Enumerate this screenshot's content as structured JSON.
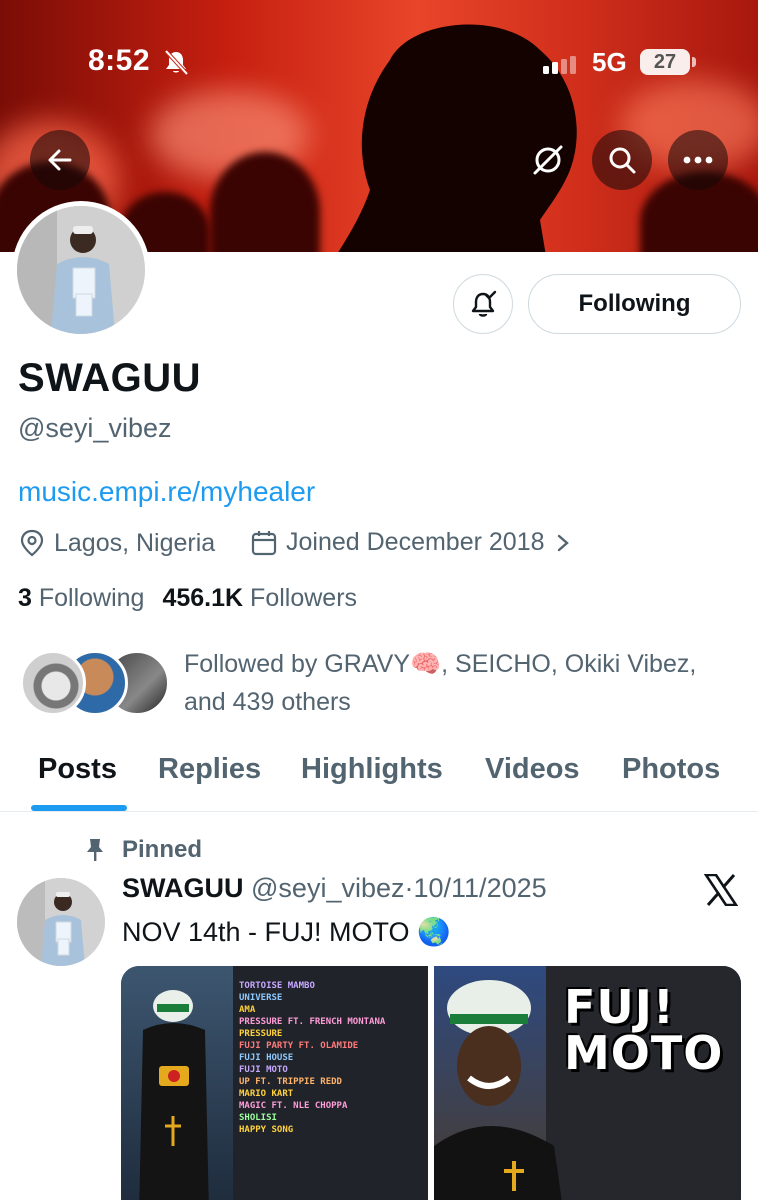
{
  "status_bar": {
    "time": "8:52",
    "network": "5G",
    "battery": "27"
  },
  "header": {
    "back_icon": "back-arrow-icon",
    "grok_icon": "slash-circle-icon",
    "search_icon": "search-icon",
    "more_icon": "more-dots-icon"
  },
  "profile": {
    "display_name": "SWAGUU",
    "handle": "@seyi_vibez",
    "link": "music.empi.re/myhealer",
    "location": "Lagos, Nigeria",
    "joined": "Joined December 2018",
    "following_count": "3",
    "following_label": "Following",
    "followers_count": "456.1K",
    "followers_label": "Followers",
    "follow_button": "Following",
    "followed_by": "Followed by GRAVY🧠, SEICHO, Okiki Vibez, and 439 others"
  },
  "tabs": [
    "Posts",
    "Replies",
    "Highlights",
    "Videos",
    "Photos"
  ],
  "pinned_post": {
    "pinned_label": "Pinned",
    "author": "SWAGUU",
    "handle": "@seyi_vibez",
    "separator": "·",
    "date": "10/11/2025",
    "text": "NOV 14th - FUJ! MOTO 🌏",
    "media_title": "FUJ! MOTO",
    "tracklist": [
      "TORTOISE MAMBO",
      "UNIVERSE",
      "AMA",
      "PRESSURE FT. FRENCH MONTANA",
      "PRESSURE",
      "FUJI PARTY FT. OLAMIDE",
      "FUJI HOUSE",
      "FUJI MOTO",
      "UP FT. TRIPPIE REDD",
      "MARIO KART",
      "MAGIC FT. NLE CHOPPA",
      "SHOLISI",
      "HAPPY SONG"
    ]
  },
  "colors": {
    "accent": "#1d9bf0",
    "text_primary": "#0f1419",
    "text_secondary": "#536471"
  }
}
